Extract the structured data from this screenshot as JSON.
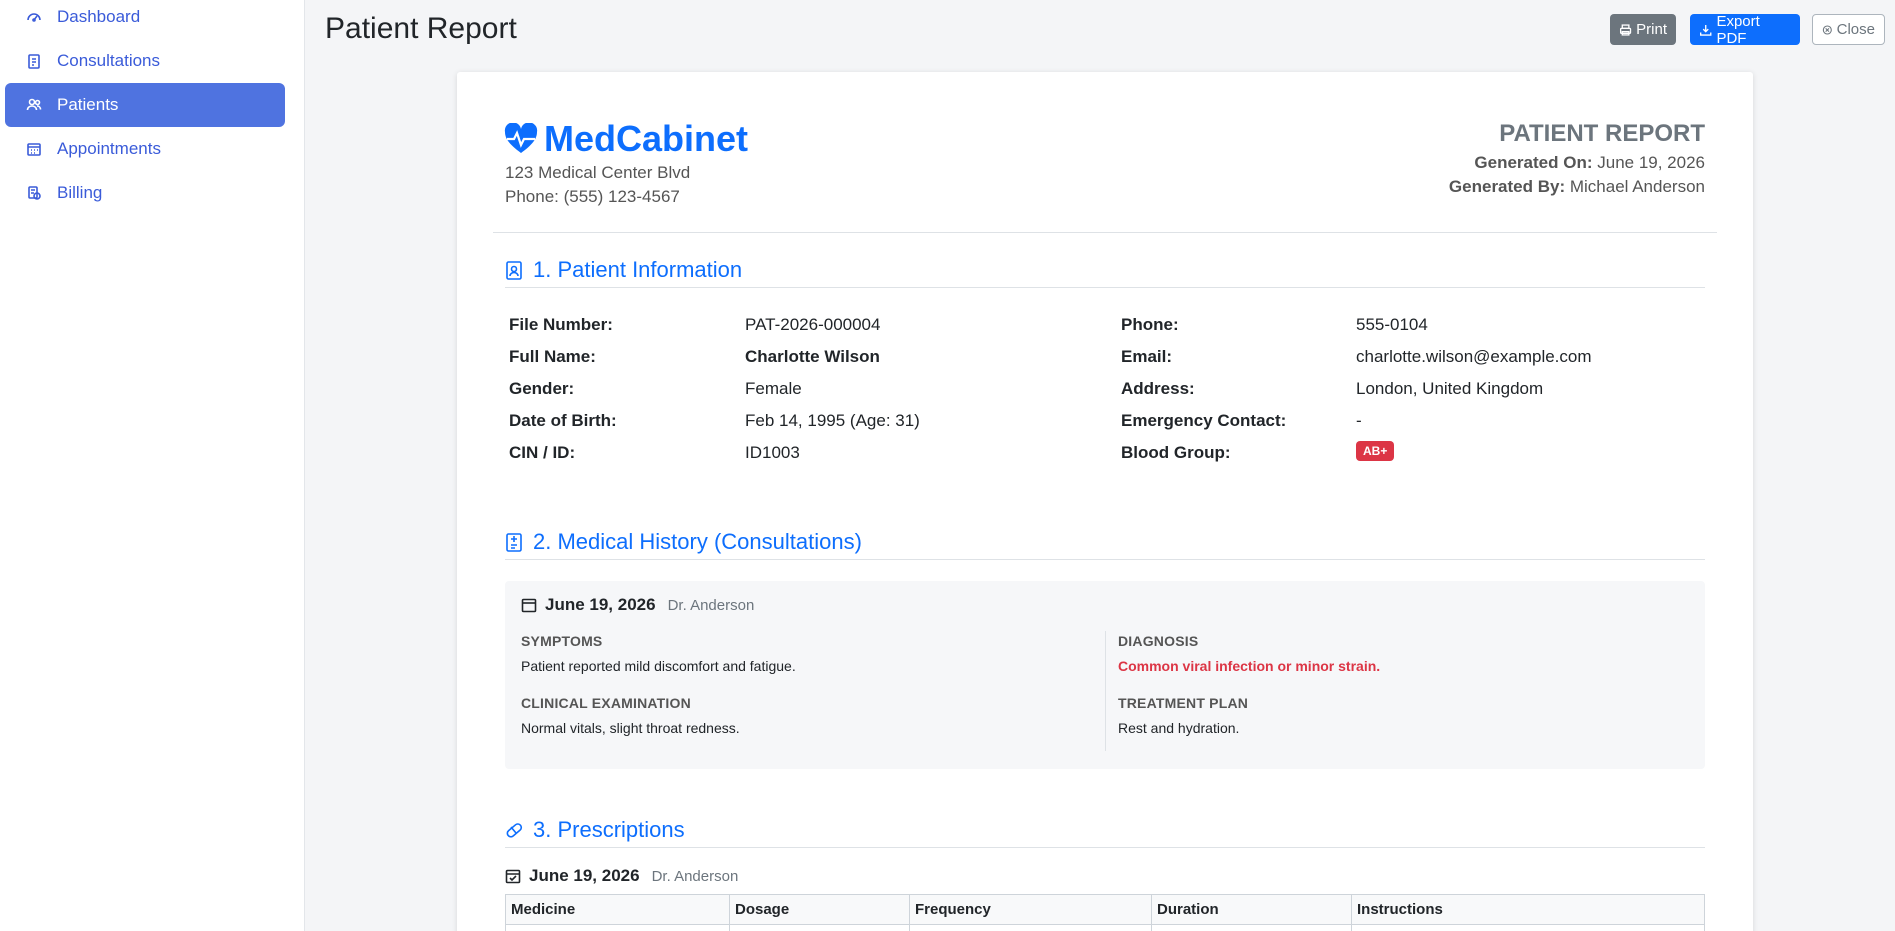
{
  "sidebar": {
    "items": [
      {
        "label": "Dashboard",
        "icon": "gauge-icon",
        "active": false
      },
      {
        "label": "Consultations",
        "icon": "clipboard-icon",
        "active": false
      },
      {
        "label": "Patients",
        "icon": "people-icon",
        "active": true
      },
      {
        "label": "Appointments",
        "icon": "calendar-grid-icon",
        "active": false
      },
      {
        "label": "Billing",
        "icon": "billing-icon",
        "active": false
      }
    ]
  },
  "header": {
    "title": "Patient Report",
    "print_label": "Print",
    "export_label": "Export PDF",
    "close_label": "Close"
  },
  "report": {
    "brand": "MedCabinet",
    "address": "123 Medical Center Blvd",
    "phone": "Phone: (555) 123-4567",
    "title": "PATIENT REPORT",
    "generated_on_label": "Generated On:",
    "generated_on": "June 19, 2026",
    "generated_by_label": "Generated By:",
    "generated_by": "Michael Anderson",
    "sections": {
      "patient_info": "1. Patient Information",
      "medical_history": "2. Medical History (Consultations)",
      "prescriptions": "3. Prescriptions"
    },
    "patient": {
      "left": [
        {
          "label": "File Number:",
          "value": "PAT-2026-000004"
        },
        {
          "label": "Full Name:",
          "value": "Charlotte Wilson"
        },
        {
          "label": "Gender:",
          "value": "Female"
        },
        {
          "label": "Date of Birth:",
          "value": "Feb 14, 1995 (Age: 31)"
        },
        {
          "label": "CIN / ID:",
          "value": "ID1003"
        }
      ],
      "right": [
        {
          "label": "Phone:",
          "value": "555-0104"
        },
        {
          "label": "Email:",
          "value": "charlotte.wilson@example.com"
        },
        {
          "label": "Address:",
          "value": "London, United Kingdom"
        },
        {
          "label": "Emergency Contact:",
          "value": "-"
        },
        {
          "label": "Blood Group:",
          "value": "AB+"
        }
      ]
    },
    "consultation": {
      "date": "June 19, 2026",
      "doctor": "Dr. Anderson",
      "symptoms_label": "SYMPTOMS",
      "symptoms": "Patient reported mild discomfort and fatigue.",
      "exam_label": "CLINICAL EXAMINATION",
      "exam": "Normal vitals, slight throat redness.",
      "diagnosis_label": "DIAGNOSIS",
      "diagnosis": "Common viral infection or minor strain.",
      "treatment_label": "TREATMENT PLAN",
      "treatment": "Rest and hydration."
    },
    "prescription": {
      "date": "June 19, 2026",
      "doctor": "Dr. Anderson",
      "columns": [
        "Medicine",
        "Dosage",
        "Frequency",
        "Duration",
        "Instructions"
      ]
    }
  },
  "colors": {
    "accent": "#0d6efd",
    "sidebar_active": "#4f73e0",
    "danger": "#dc3545"
  }
}
